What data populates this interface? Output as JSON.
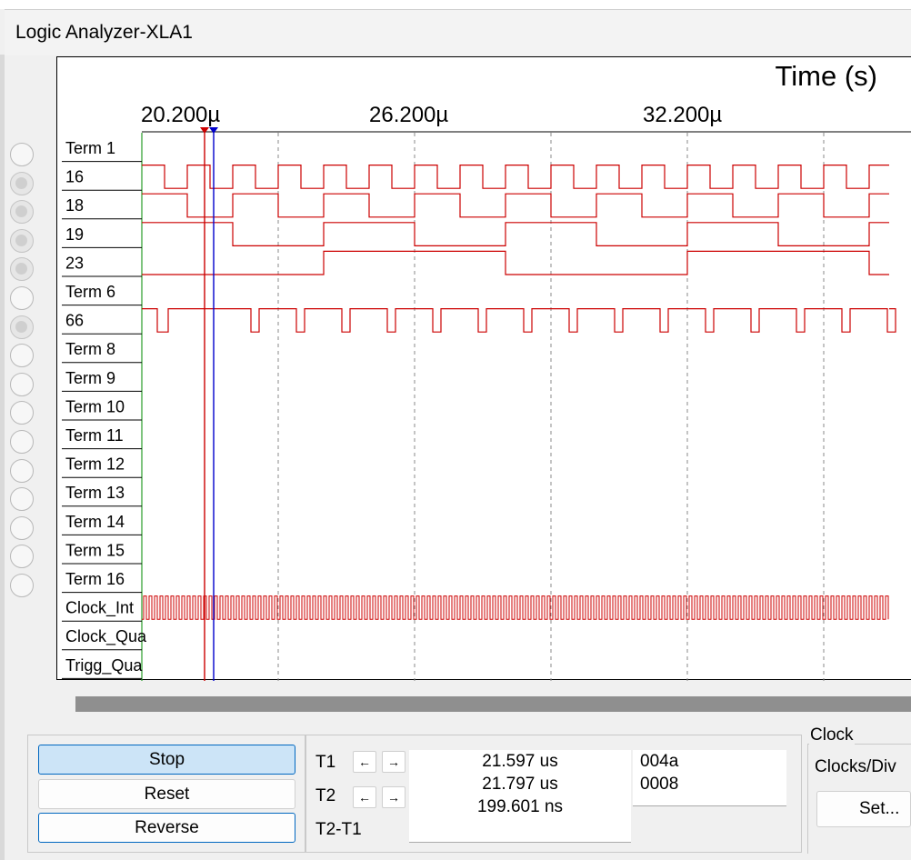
{
  "window": {
    "title": "Logic Analyzer-XLA1"
  },
  "plot": {
    "time_title": "Time (s)",
    "time_labels": [
      "20.200µ",
      "26.200µ",
      "32.200µ"
    ],
    "channels": [
      {
        "label": "Term 1",
        "enabled": false
      },
      {
        "label": "16",
        "enabled": true
      },
      {
        "label": "18",
        "enabled": true
      },
      {
        "label": "19",
        "enabled": true
      },
      {
        "label": "23",
        "enabled": true
      },
      {
        "label": "Term 6",
        "enabled": false
      },
      {
        "label": "66",
        "enabled": true
      },
      {
        "label": "Term 8",
        "enabled": false
      },
      {
        "label": "Term 9",
        "enabled": false
      },
      {
        "label": "Term 10",
        "enabled": false
      },
      {
        "label": "Term 11",
        "enabled": false
      },
      {
        "label": "Term 12",
        "enabled": false
      },
      {
        "label": "Term 13",
        "enabled": false
      },
      {
        "label": "Term 14",
        "enabled": false
      },
      {
        "label": "Term 15",
        "enabled": false
      },
      {
        "label": "Term 16",
        "enabled": false
      },
      {
        "label": "Clock_Int",
        "enabled": false
      },
      {
        "label": "Clock_Qua",
        "enabled": false
      },
      {
        "label": "Trigg_Qua",
        "enabled": false
      }
    ],
    "trace_color": "#cc0000",
    "cursor_t1_color": "#cc0000",
    "cursor_t2_color": "#0000cc"
  },
  "controls": {
    "stop": "Stop",
    "reset": "Reset",
    "reverse": "Reverse"
  },
  "cursors": {
    "t1_label": "T1",
    "t2_label": "T2",
    "diff_label": "T2-T1",
    "t1_value": "21.597 us",
    "t2_value": "21.797 us",
    "diff_value": "199.601 ns",
    "t1_hex": "004a",
    "t2_hex": "0008",
    "left_arrow": "←",
    "right_arrow": "→"
  },
  "clock": {
    "group_label": "Clock",
    "clocks_per_div": "Clocks/Div",
    "set_button": "Set..."
  }
}
